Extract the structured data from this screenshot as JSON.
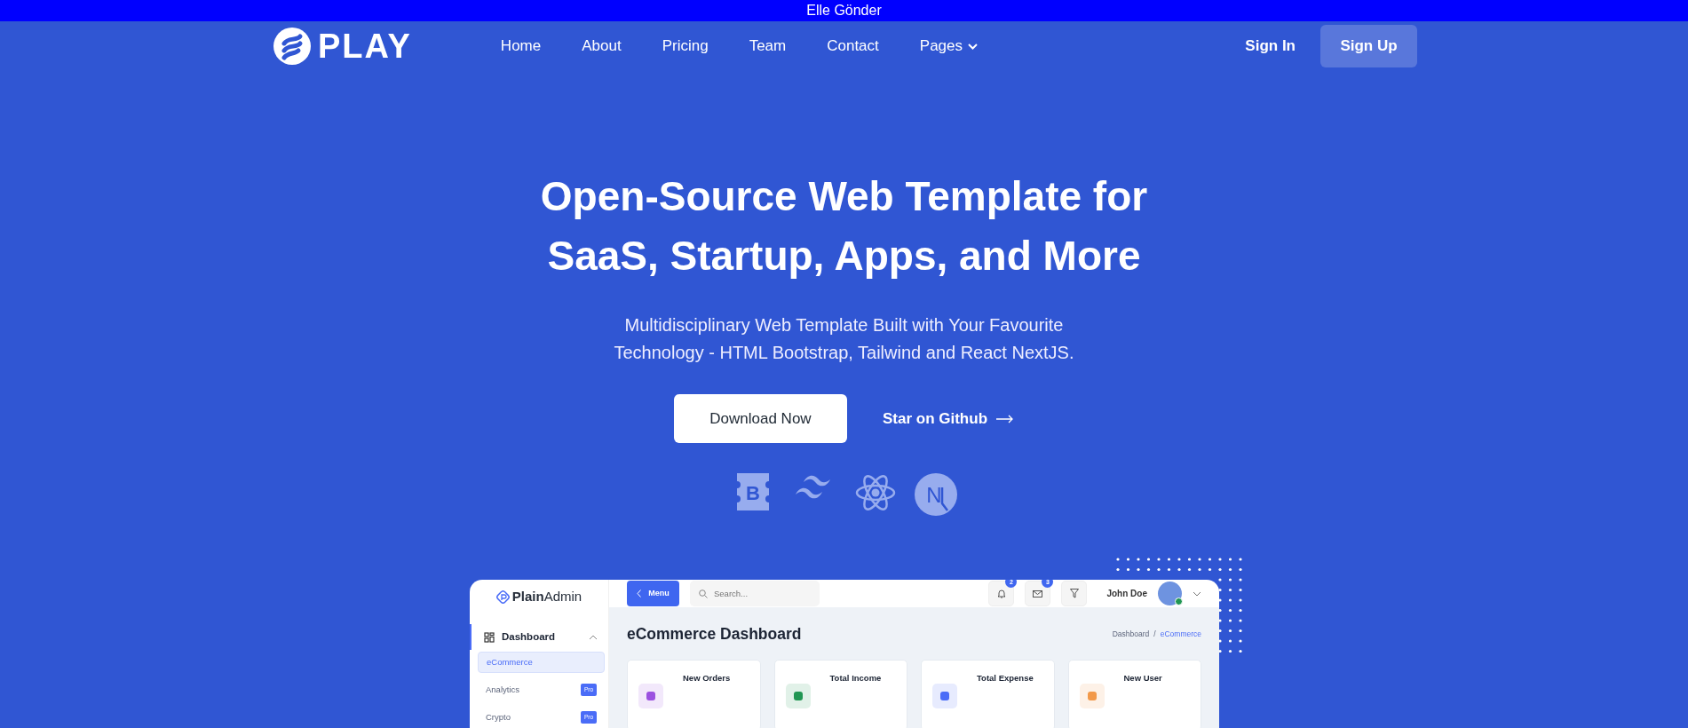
{
  "announcement": {
    "text": "Elle Gönder"
  },
  "navbar": {
    "brand": "PLAY",
    "links": [
      {
        "label": "Home",
        "dropdown": false
      },
      {
        "label": "About",
        "dropdown": false
      },
      {
        "label": "Pricing",
        "dropdown": false
      },
      {
        "label": "Team",
        "dropdown": false
      },
      {
        "label": "Contact",
        "dropdown": false
      },
      {
        "label": "Pages",
        "dropdown": true
      }
    ],
    "sign_in": "Sign In",
    "sign_up": "Sign Up"
  },
  "hero": {
    "title": "Open-Source Web Template for SaaS, Startup, Apps, and More",
    "subtitle": "Multidisciplinary Web Template Built with Your Favourite Technology - HTML Bootstrap, Tailwind and React NextJS.",
    "primary_button": "Download Now",
    "secondary_link": "Star on Github",
    "tech_logos": [
      {
        "kind": "bootstrap",
        "letter": "B"
      },
      {
        "kind": "tailwind"
      },
      {
        "kind": "react"
      },
      {
        "kind": "nextjs",
        "letter": "N"
      }
    ]
  },
  "dashboard_preview": {
    "brand": "**Plain**Admin",
    "menu_button": "Menu",
    "search": {
      "placeholder": "Search..."
    },
    "header_icons": [
      {
        "kind": "bell",
        "badge": "2"
      },
      {
        "kind": "mail",
        "badge": "3"
      },
      {
        "kind": "filter"
      }
    ],
    "user": {
      "name": "John Doe",
      "online": true
    },
    "sidebar": [
      {
        "label": "Dashboard",
        "expanded": true,
        "children": [
          {
            "label": "eCommerce",
            "selected": true
          },
          {
            "label": "Analytics",
            "badge": "Pro",
            "selected": false
          },
          {
            "label": "Crypto",
            "badge": "Pro",
            "selected": false
          }
        ]
      }
    ],
    "page_title": "eCommerce Dashboard",
    "breadcrumb": [
      {
        "label": "Dashboard",
        "selected": false
      },
      {
        "label": "eCommerce",
        "selected": true
      }
    ],
    "breadcrumb_separator": "/",
    "stat_cards": [
      {
        "title": "New Orders",
        "color": "#9b51e0"
      },
      {
        "title": "Total Income",
        "color": "#219653"
      },
      {
        "title": "Total Expense",
        "color": "#4a6cf7"
      },
      {
        "title": "New User",
        "color": "#f2994a"
      }
    ]
  }
}
